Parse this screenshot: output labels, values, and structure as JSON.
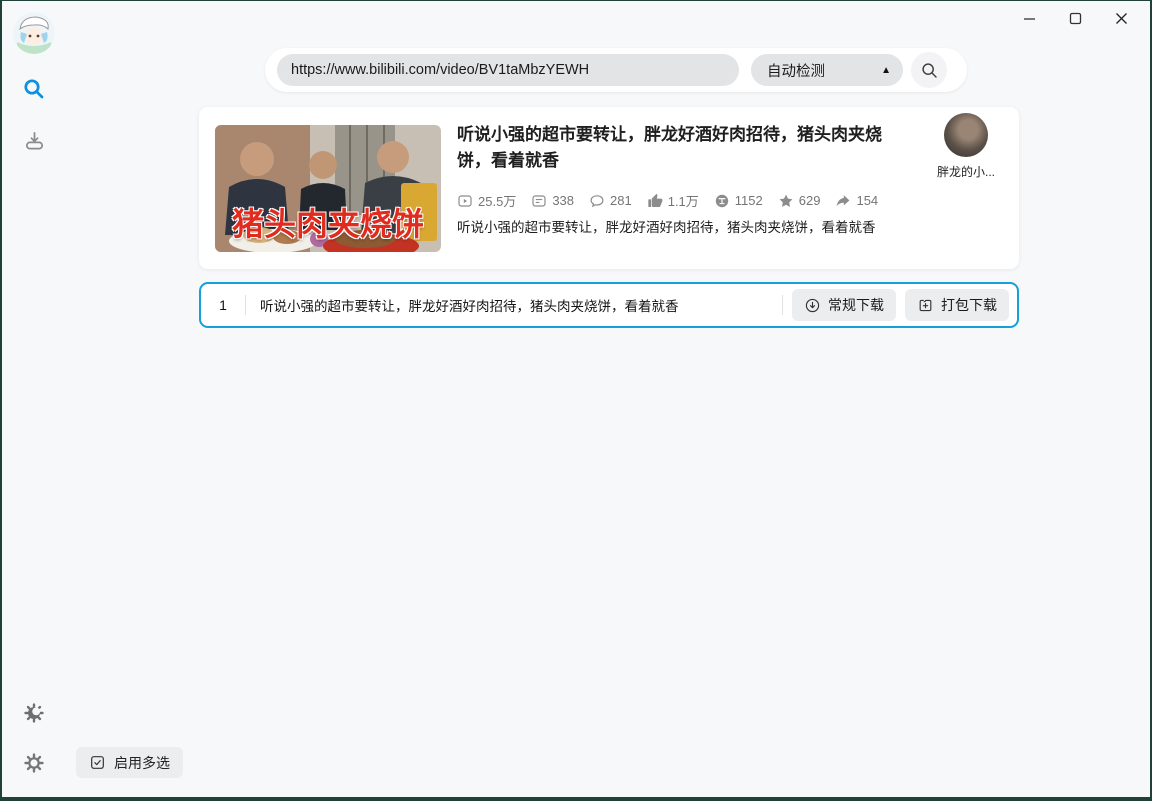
{
  "search_bar": {
    "url_value": "https://www.bilibili.com/video/BV1taMbzYEWH",
    "detect_label": "自动检测",
    "detect_arrow": "▲"
  },
  "video": {
    "title": "听说小强的超市要转让，胖龙好酒好肉招待，猪头肉夹烧饼，看着就香",
    "thumbnail_caption": "猪头肉夹烧饼",
    "description": "听说小强的超市要转让，胖龙好酒好肉招待，猪头肉夹烧饼，看着就香",
    "uploader_name": "胖龙的小...",
    "stats": [
      {
        "name": "play",
        "value": "25.5万"
      },
      {
        "name": "danmaku",
        "value": "338"
      },
      {
        "name": "comment",
        "value": "281"
      },
      {
        "name": "like",
        "value": "1.1万"
      },
      {
        "name": "coin",
        "value": "1152"
      },
      {
        "name": "favorite",
        "value": "629"
      },
      {
        "name": "share",
        "value": "154"
      }
    ]
  },
  "download_row": {
    "index": "1",
    "title": "听说小强的超市要转让，胖龙好酒好肉招待，猪头肉夹烧饼，看着就香",
    "buttons": [
      {
        "label": "常规下载"
      },
      {
        "label": "打包下载"
      }
    ]
  },
  "footer": {
    "multi_select_label": "启用多选"
  },
  "colors": {
    "accent_blue": "#14a0d8",
    "active_icon_blue": "#0e90e0",
    "thumbnail_text_red": "#e02c1e",
    "window_border": "#1e4138"
  }
}
